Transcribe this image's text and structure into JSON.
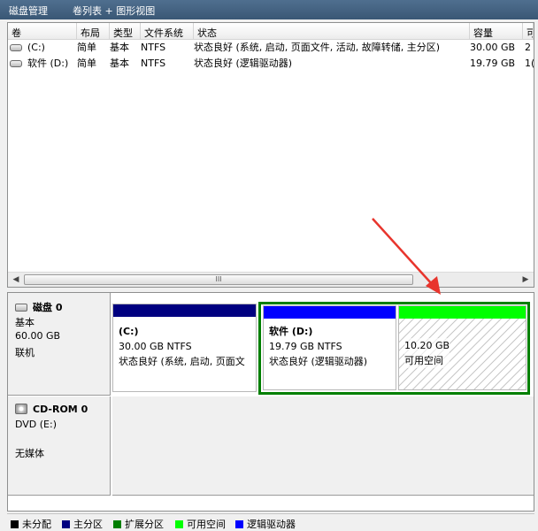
{
  "titlebar": {
    "title": "磁盘管理",
    "view": "卷列表 + 图形视图"
  },
  "columns": [
    "卷",
    "布局",
    "类型",
    "文件系统",
    "状态",
    "容量",
    "可"
  ],
  "volumes": [
    {
      "name": "(C:)",
      "layout": "简单",
      "type": "基本",
      "fs": "NTFS",
      "status": "状态良好 (系统, 启动, 页面文件, 活动, 故障转储, 主分区)",
      "capacity": "30.00 GB",
      "free": "2"
    },
    {
      "name": "软件 (D:)",
      "layout": "简单",
      "type": "基本",
      "fs": "NTFS",
      "status": "状态良好 (逻辑驱动器)",
      "capacity": "19.79 GB",
      "free": "1("
    }
  ],
  "scrollbar": {
    "left": "◀",
    "right": "▶",
    "grip": "III"
  },
  "disks": [
    {
      "name": "磁盘 0",
      "type": "基本",
      "size": "60.00 GB",
      "state": "联机"
    },
    {
      "name": "CD-ROM 0",
      "type": "DVD (E:)",
      "state": "无媒体"
    }
  ],
  "partitions": [
    {
      "title": "(C:)",
      "size": "30.00 GB NTFS",
      "status": "状态良好 (系统, 启动, 页面文",
      "color": "#000080"
    },
    {
      "title": "软件  (D:)",
      "size": "19.79 GB NTFS",
      "status": "状态良好 (逻辑驱动器)",
      "color": "#0000ff"
    },
    {
      "size": "10.20 GB",
      "status": "可用空间",
      "color": "#00ff00"
    }
  ],
  "extended_partition_color": "#007f00",
  "legend": [
    {
      "label": "未分配",
      "color": "#000000"
    },
    {
      "label": "主分区",
      "color": "#000080"
    },
    {
      "label": "扩展分区",
      "color": "#007f00"
    },
    {
      "label": "可用空间",
      "color": "#00ff00"
    },
    {
      "label": "逻辑驱动器",
      "color": "#0000ff"
    }
  ],
  "annotation": {
    "type": "red-arrow",
    "color": "#e8352d",
    "points_to": "free-space-partition"
  }
}
